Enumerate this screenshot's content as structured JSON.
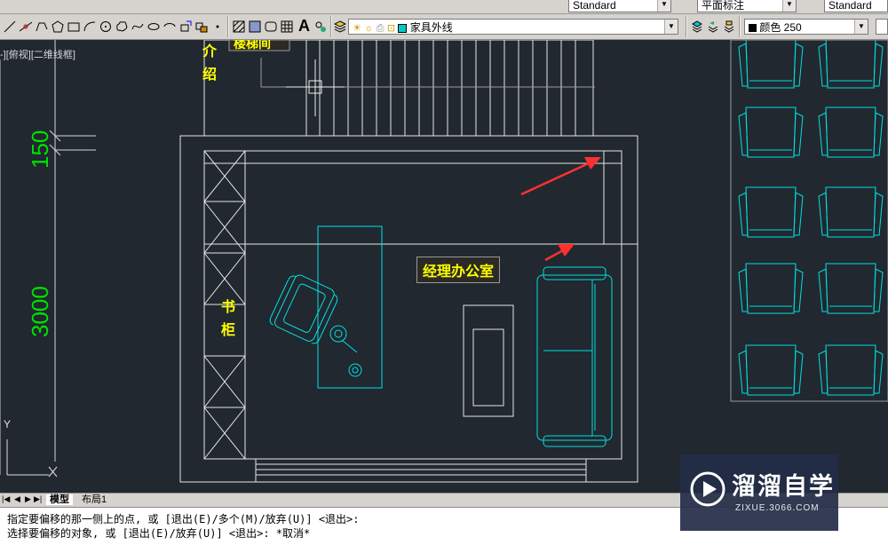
{
  "toolbar": {
    "row1": {
      "text_style": "Standard",
      "dim_style": "平面标注",
      "table_style": "Standard"
    },
    "row2": {
      "layer": "家具外线",
      "color": "颜色 250",
      "text_icon": "A"
    }
  },
  "viewport": {
    "view_label": "-][俯视][二维线框]"
  },
  "drawing": {
    "dims": [
      "150",
      "3000"
    ],
    "labels": {
      "stair_title": "楼梯间",
      "intro_1": "介",
      "intro_2": "绍",
      "office": "经理办公室",
      "bookcase_1": "书",
      "bookcase_2": "柜"
    },
    "ucs": {
      "x": "X",
      "y": "Y"
    }
  },
  "tabs": {
    "model": "模型",
    "layout": "布局1"
  },
  "command": {
    "line1": "指定要偏移的那一侧上的点, 或 [退出(E)/多个(M)/放弃(U)] <退出>:",
    "line2": "选择要偏移的对象, 或 [退出(E)/放弃(U)] <退出>: *取消*"
  },
  "watermark": {
    "brand": "溜溜自学",
    "url": "ZIXUE.3066.COM"
  },
  "colors": {
    "canvas_bg": "#212830",
    "furniture": "#00ffff",
    "dimension": "#00ff00",
    "annotation": "#ffff00",
    "arrow": "#ff3030",
    "lines": "#e6e6e6"
  }
}
